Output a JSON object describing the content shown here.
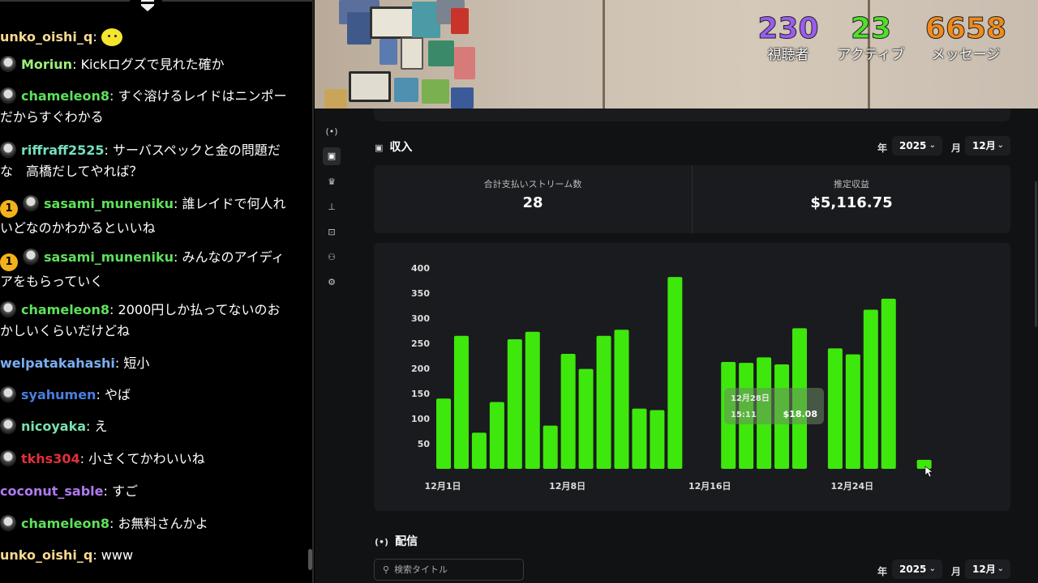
{
  "chat": {
    "messages": [
      {
        "user": "unko_oishi_q",
        "color": "#f7d990",
        "text": "",
        "avatar": false,
        "badge": "",
        "emote": true
      },
      {
        "user": "Moriun",
        "color": "#9ef07a",
        "text": "Kickログズで見れた確か",
        "avatar": true,
        "badge": ""
      },
      {
        "user": "chameleon8",
        "color": "#5ee05a",
        "text": "すぐ溶けるレイドはニンポーだからすぐわかる",
        "avatar": true,
        "badge": ""
      },
      {
        "user": "riffraff2525",
        "color": "#72e0c0",
        "text": "サーバスペックと金の問題だな　高橋だしてやれば？",
        "avatar": true,
        "badge": ""
      },
      {
        "user": "sasami_muneniku",
        "color": "#5ee05a",
        "text": "誰レイドで何人れいどなのかわかるといいね",
        "avatar": true,
        "badge": "1"
      },
      {
        "user": "sasami_muneniku",
        "color": "#5ee05a",
        "text": "みんなのアイディアをもらっていく",
        "avatar": true,
        "badge": "1"
      },
      {
        "user": "chameleon8",
        "color": "#5ee05a",
        "text": "2000円しか払ってないのおかしいくらいだけどね",
        "avatar": true,
        "badge": ""
      },
      {
        "user": "welpatakahashi",
        "color": "#7aaef0",
        "text": "短小",
        "avatar": false,
        "badge": ""
      },
      {
        "user": "syahumen",
        "color": "#4a7fe0",
        "text": "やば",
        "avatar": true,
        "badge": ""
      },
      {
        "user": "nicoyaka",
        "color": "#7ae0b0",
        "text": "え",
        "avatar": true,
        "badge": ""
      },
      {
        "user": "tkhs304",
        "color": "#e0303a",
        "text": "小さくてかわいいね",
        "avatar": true,
        "badge": ""
      },
      {
        "user": "coconut_sable",
        "color": "#b07af0",
        "text": "すご",
        "avatar": false,
        "badge": ""
      },
      {
        "user": "chameleon8",
        "color": "#5ee05a",
        "text": "お無料さんかよ",
        "avatar": true,
        "badge": ""
      },
      {
        "user": "unko_oishi_q",
        "color": "#f7d990",
        "text": "www",
        "avatar": false,
        "badge": ""
      }
    ]
  },
  "overlay": {
    "viewers": {
      "value": "230",
      "label": "視聴者",
      "color": "#9b5cf0"
    },
    "active": {
      "value": "23",
      "label": "アクティブ",
      "color": "#4ee02a"
    },
    "messages": {
      "value": "6658",
      "label": "メッセージ",
      "color": "#f08a1a"
    }
  },
  "sidebar": {
    "icons": [
      "broadcast-icon",
      "chart-icon",
      "trophy-icon",
      "inbox-icon",
      "camera-icon",
      "users-icon",
      "gear-icon"
    ],
    "glyphs": [
      "(•)",
      "▣",
      "♛",
      "⊥",
      "⊡",
      "⚇",
      "⚙"
    ]
  },
  "revenue": {
    "title": "収入",
    "year_label": "年",
    "year_value": "2025",
    "month_label": "月",
    "month_value": "12月",
    "kpi1_title": "合計支払いストリーム数",
    "kpi1_value": "28",
    "kpi2_title": "推定収益",
    "kpi2_value": "$5,116.75"
  },
  "chart_data": {
    "type": "bar",
    "color": "#3ee80c",
    "ylim": [
      0,
      400
    ],
    "yticks": [
      50,
      100,
      150,
      200,
      250,
      300,
      350,
      400
    ],
    "x_days": [
      1,
      2,
      3,
      4,
      5,
      6,
      7,
      8,
      9,
      10,
      11,
      12,
      13,
      14,
      17,
      18,
      19,
      20,
      21,
      23,
      24,
      25,
      26,
      28
    ],
    "values": [
      140,
      265,
      72,
      133,
      258,
      273,
      86,
      229,
      199,
      265,
      277,
      120,
      117,
      382,
      213,
      211,
      222,
      208,
      280,
      240,
      228,
      317,
      339,
      18
    ],
    "x_tick_labels": [
      {
        "day": 1,
        "label": "12月1日"
      },
      {
        "day": 8,
        "label": "12月8日"
      },
      {
        "day": 16,
        "label": "12月16日"
      },
      {
        "day": 24,
        "label": "12月24日"
      }
    ],
    "tooltip": {
      "date": "12月28日",
      "time": "15:11",
      "value": "$18.08"
    }
  },
  "streams": {
    "title": "配信",
    "search_placeholder": "検索タイトル",
    "year_label": "年",
    "year_value": "2025",
    "month_label": "月",
    "month_value": "12月"
  }
}
